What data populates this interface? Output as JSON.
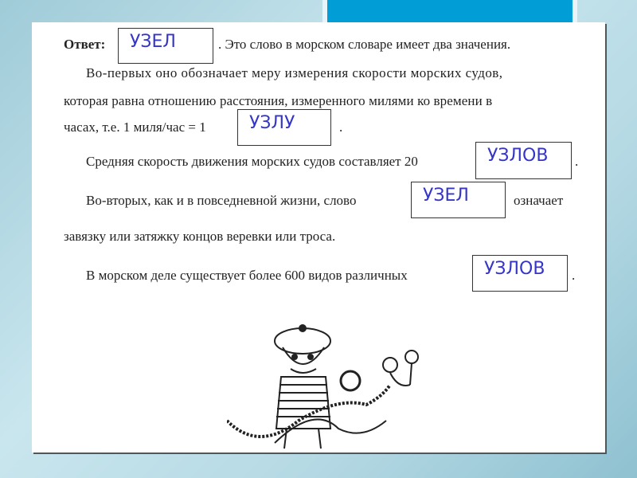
{
  "document": {
    "answer_label": "Ответ:",
    "line1_rest": ". Это слово в морском словаре имеет два значения.",
    "line2": "Во-первых оно обозначает меру измерения скорости морских судов,",
    "line3": "которая равна отношению расстояния, измеренного милями ко времени в",
    "line4_start": "часах, т.е. 1 миля/час = 1",
    "line4_end": ".",
    "line5_start": "Средняя скорость движения морских судов составляет 20",
    "line5_end": ".",
    "line6_start": "Во-вторых, как и в повседневной жизни, слово",
    "line6_end": "означает",
    "line7": "завязку или затяжку концов веревки или троса.",
    "line8_start": "В морском деле существует более 600 видов различных",
    "line8_end": "."
  },
  "answers": [
    "УЗЕЛ",
    "УЗЛУ",
    "УЗЛОВ",
    "УЗЕЛ",
    "УЗЛОВ"
  ],
  "colors": {
    "answer_text": "#3535c8",
    "top_bar": "#009dd6"
  }
}
